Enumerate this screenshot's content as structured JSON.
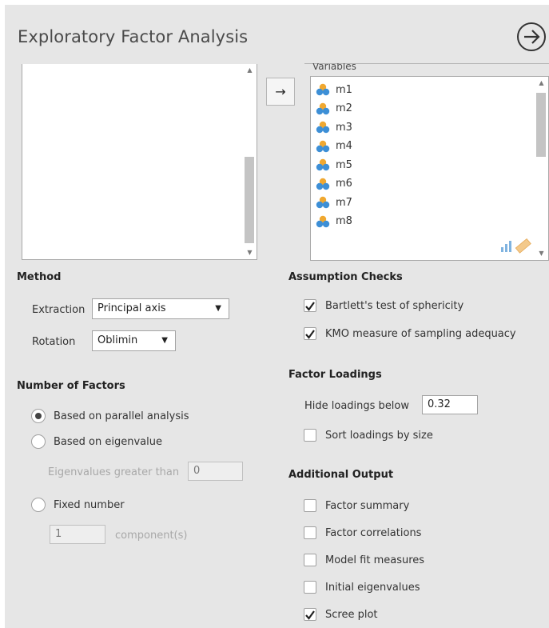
{
  "dialog": {
    "title": "Exploratory Factor Analysis",
    "run_icon": "arrow-right-circle-icon"
  },
  "variables": {
    "label": "Variables",
    "move_button": "→",
    "items": [
      "m1",
      "m2",
      "m3",
      "m4",
      "m5",
      "m6",
      "m7",
      "m8"
    ],
    "item_icon": "nominal-variable-icon"
  },
  "method": {
    "heading": "Method",
    "extraction_label": "Extraction",
    "extraction_value": "Principal axis",
    "rotation_label": "Rotation",
    "rotation_value": "Oblimin",
    "caret": "▼"
  },
  "number_of_factors": {
    "heading": "Number of Factors",
    "parallel": "Based on parallel analysis",
    "eigenvalue": "Based on eigenvalue",
    "eigen_greater_label": "Eigenvalues greater than",
    "eigen_greater_value": "0",
    "fixed": "Fixed number",
    "fixed_value": "1",
    "component_label": "component(s)",
    "selected": "parallel"
  },
  "assumption_checks": {
    "heading": "Assumption Checks",
    "bartlett": "Bartlett's test of sphericity",
    "bartlett_checked": true,
    "kmo": "KMO measure of sampling adequacy",
    "kmo_checked": true
  },
  "factor_loadings": {
    "heading": "Factor Loadings",
    "hide_label": "Hide loadings below",
    "hide_value": "0.32",
    "sort_label": "Sort loadings by size",
    "sort_checked": false
  },
  "additional_output": {
    "heading": "Additional Output",
    "items": [
      {
        "label": "Factor summary",
        "checked": false
      },
      {
        "label": "Factor correlations",
        "checked": false
      },
      {
        "label": "Model fit measures",
        "checked": false
      },
      {
        "label": "Initial eigenvalues",
        "checked": false
      },
      {
        "label": "Scree plot",
        "checked": true
      }
    ]
  },
  "colors": {
    "panel_bg": "#e6e6e6",
    "variable_icon_orange": "#f0a830",
    "variable_icon_blue": "#3d8fd6"
  }
}
